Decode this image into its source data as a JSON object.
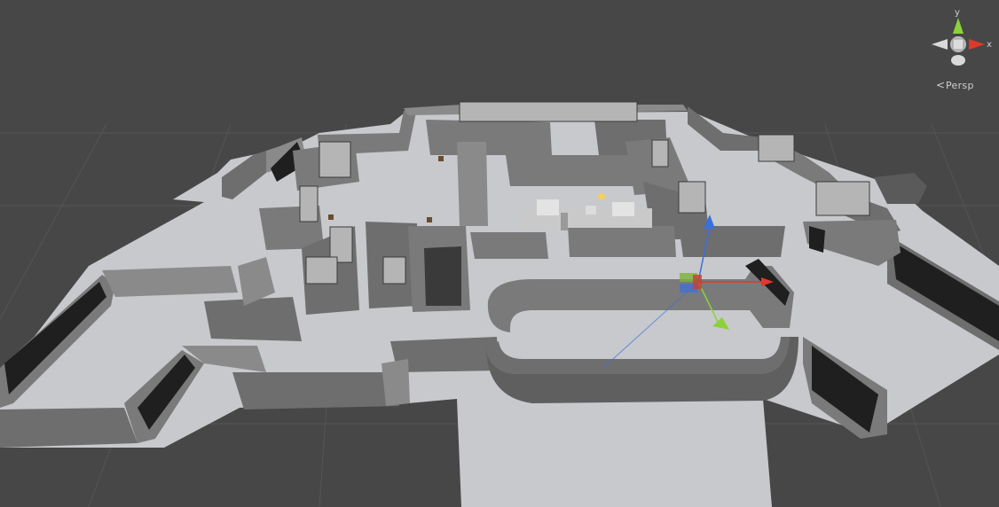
{
  "scene_view": {
    "projection_label": "Persp",
    "axis_labels": {
      "y": "y",
      "x": "x"
    }
  },
  "colors": {
    "background": "#474747",
    "grid_line": "#555555",
    "floor": "#c7c9cc",
    "wall_top": "#8a8a8a",
    "wall_face": "#6e6e6e",
    "wall_dark": "#1f1f1f",
    "gizmo_x": "#e0392b",
    "gizmo_y": "#8bd23a",
    "gizmo_z": "#3b6fe0"
  }
}
